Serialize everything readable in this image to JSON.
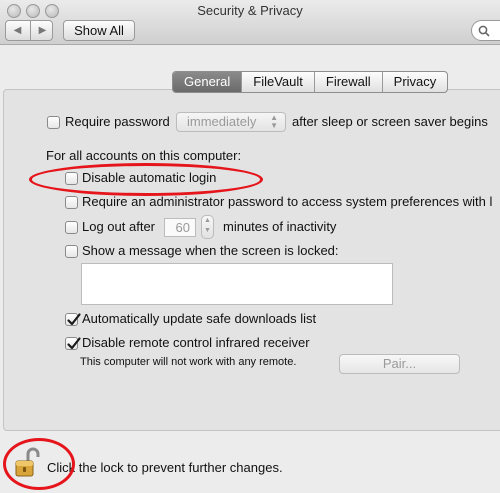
{
  "window": {
    "title": "Security & Privacy",
    "show_all_label": "Show All",
    "back_icon": "chevron-left-icon",
    "forward_icon": "chevron-right-icon"
  },
  "tabs": [
    {
      "label": "General",
      "active": true
    },
    {
      "label": "FileVault",
      "active": false
    },
    {
      "label": "Firewall",
      "active": false
    },
    {
      "label": "Privacy",
      "active": false
    }
  ],
  "general": {
    "require_password_label": "Require password",
    "require_password_checked": false,
    "password_delay_value": "immediately",
    "after_sleep_label": "after sleep or screen saver begins",
    "all_accounts_heading": "For all accounts on this computer:",
    "disable_auto_login_label": "Disable automatic login",
    "require_admin_label": "Require an administrator password to access system preferences with l",
    "logout_after_label": "Log out after",
    "logout_minutes_value": "60",
    "minutes_inactivity_label": "minutes of inactivity",
    "show_message_label": "Show a message when the screen is locked:",
    "auto_update_label": "Automatically update safe downloads list",
    "auto_update_checked": true,
    "disable_ir_label": "Disable remote control infrared receiver",
    "disable_ir_checked": true,
    "ir_note": "This computer will not work with any remote.",
    "pair_label": "Pair..."
  },
  "footer": {
    "lock_text": "Click the lock to prevent further changes.",
    "lock_icon": "unlocked-padlock-icon"
  },
  "colors": {
    "annotation_red": "#e5151b",
    "active_tab": "#777777"
  }
}
